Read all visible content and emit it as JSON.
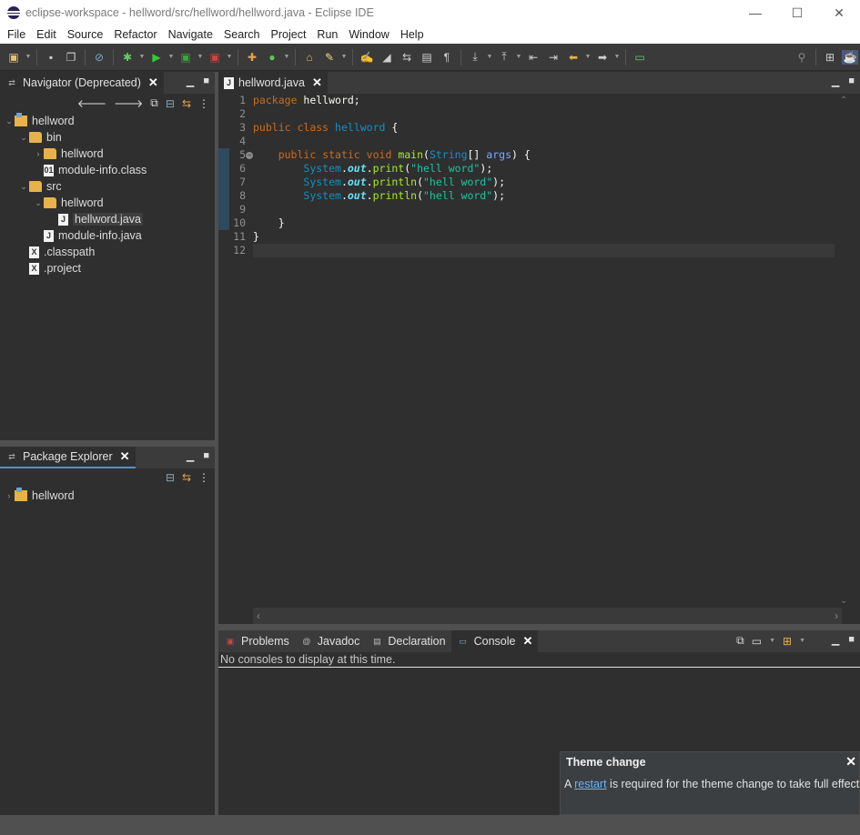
{
  "window": {
    "title": "eclipse-workspace - hellword/src/hellword/hellword.java - Eclipse IDE",
    "minimize": "—",
    "maximize": "☐",
    "close": "✕"
  },
  "menu": [
    "File",
    "Edit",
    "Source",
    "Refactor",
    "Navigate",
    "Search",
    "Project",
    "Run",
    "Window",
    "Help"
  ],
  "navigator": {
    "tab": "Navigator (Deprecated)",
    "tree": [
      {
        "label": "hellword",
        "icon": "project-icon"
      },
      {
        "label": "bin",
        "icon": "folder-icon"
      },
      {
        "label": "hellword",
        "icon": "folder-icon"
      },
      {
        "label": "module-info.class",
        "icon": "class-file-icon"
      },
      {
        "label": "src",
        "icon": "folder-icon"
      },
      {
        "label": "hellword",
        "icon": "folder-icon"
      },
      {
        "label": "hellword.java",
        "icon": "java-file-icon"
      },
      {
        "label": "module-info.java",
        "icon": "java-file-icon"
      },
      {
        "label": ".classpath",
        "icon": "xml-file-icon"
      },
      {
        "label": ".project",
        "icon": "xml-file-icon"
      }
    ]
  },
  "package_explorer": {
    "tab": "Package Explorer",
    "tree": [
      {
        "label": "hellword",
        "icon": "project-icon"
      }
    ]
  },
  "editor": {
    "tab": "hellword.java",
    "line_numbers": [
      "1",
      "2",
      "3",
      "4",
      "5",
      "6",
      "7",
      "8",
      "9",
      "10",
      "11",
      "12"
    ]
  },
  "bottom": {
    "tabs": [
      "Problems",
      "Javadoc",
      "Declaration",
      "Console"
    ],
    "active_tab": "Console",
    "console_message": "No consoles to display at this time."
  },
  "notification": {
    "title": "Theme change",
    "prefix": "A ",
    "link": "restart",
    "suffix": " is required for the theme change to take full effect."
  }
}
